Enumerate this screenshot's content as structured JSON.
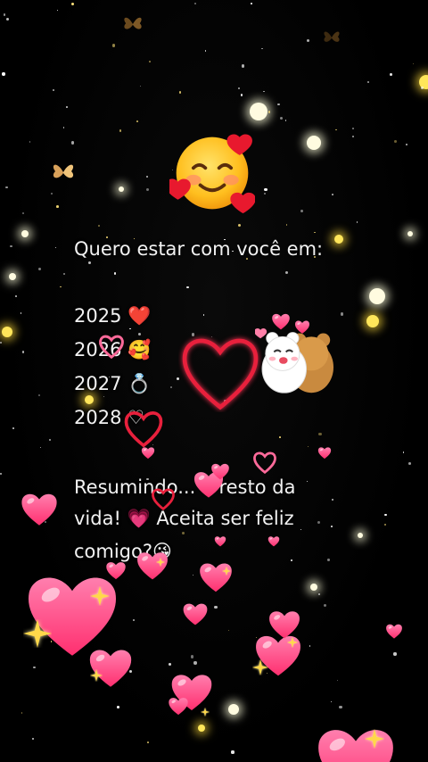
{
  "message": {
    "heading": "Quero estar com você em:",
    "years": [
      {
        "year": "2025",
        "emoji": "❤️"
      },
      {
        "year": "2026",
        "emoji": "🥰"
      },
      {
        "year": "2027",
        "emoji": "💍"
      },
      {
        "year": "2028",
        "emoji": "♡"
      }
    ],
    "line1": "Resumindo... o resto da",
    "line2": "vida! 💗 Aceita ser feliz",
    "line3": "comigo?😘"
  },
  "icons": {
    "face": "smiling-face-with-hearts-icon",
    "bear": "hugging-bears-sticker",
    "hearts": "heart-icon",
    "butterfly": "butterfly-icon"
  },
  "colors": {
    "background": "#000000",
    "text": "#f2f2f2",
    "heart_pink": "#ff3d7f",
    "heart_outline": "#e8203c",
    "sparkle": "#ffd84a"
  }
}
